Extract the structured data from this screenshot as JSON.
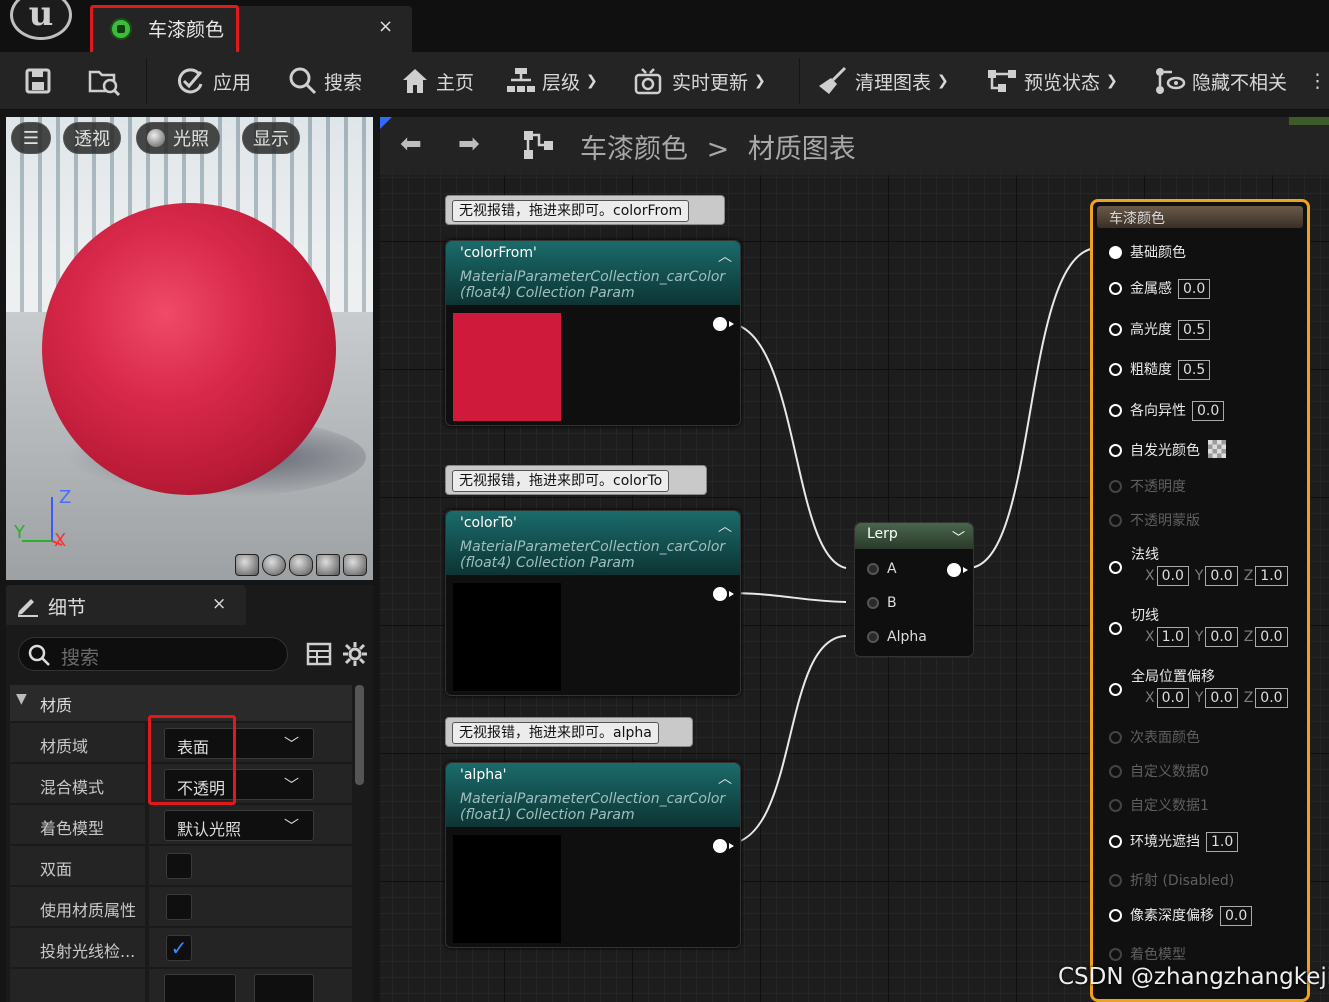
{
  "app": {
    "logo": "unreal-engine-logo"
  },
  "tab": {
    "title": "车漆颜色",
    "close": "×",
    "icon": "material-instance-icon"
  },
  "toolbar": {
    "save": "save-icon",
    "browse": "browse-icon",
    "apply": "应用",
    "search": "搜索",
    "home": "主页",
    "hierarchy": "层级",
    "live_update": "实时更新",
    "clean_graph": "清理图表",
    "preview_state": "预览状态",
    "hide_unrelated": "隐藏不相关",
    "more": "⋮"
  },
  "viewport": {
    "menu": "☰",
    "perspective": "透视",
    "lighting": "光照",
    "show": "显示",
    "axis_z": "Z",
    "axis_x": "X",
    "axis_y": "Y",
    "preview_color": "#cf1a3c"
  },
  "details": {
    "title": "细节",
    "close": "×",
    "search_placeholder": "搜索",
    "category": "材质",
    "rows": [
      {
        "label": "材质域",
        "value": "表面"
      },
      {
        "label": "混合模式",
        "value": "不透明"
      },
      {
        "label": "着色模型",
        "value": "默认光照"
      },
      {
        "label": "双面",
        "checked": false
      },
      {
        "label": "使用材质属性",
        "checked": false
      },
      {
        "label": "投射光线检...",
        "checked": true
      }
    ]
  },
  "graph": {
    "breadcrumb_asset": "车漆颜色",
    "breadcrumb_sep": ">",
    "breadcrumb_page": "材质图表",
    "comments": [
      "无视报错，拖进来即可。colorFrom",
      "无视报错，拖进来即可。colorTo",
      "无视报错，拖进来即可。alpha"
    ],
    "param_nodes": [
      {
        "name": "'colorFrom'",
        "sub1": "MaterialParameterCollection_carColor",
        "sub2": "(float4) Collection Param",
        "color": "#cf1a3c"
      },
      {
        "name": "'colorTo'",
        "sub1": "MaterialParameterCollection_carColor",
        "sub2": "(float4) Collection Param",
        "color": "#000000"
      },
      {
        "name": "'alpha'",
        "sub1": "MaterialParameterCollection_carColor",
        "sub2": "(float1) Collection Param",
        "color": "#000000"
      }
    ],
    "lerp": {
      "title": "Lerp",
      "a": "A",
      "b": "B",
      "alpha": "Alpha"
    },
    "result": {
      "title": "车漆颜色",
      "inputs": [
        {
          "label": "基础颜色"
        },
        {
          "label": "金属感",
          "value": "0.0"
        },
        {
          "label": "高光度",
          "value": "0.5"
        },
        {
          "label": "粗糙度",
          "value": "0.5"
        },
        {
          "label": "各向异性",
          "value": "0.0"
        },
        {
          "label": "自发光颜色"
        },
        {
          "label": "不透明度"
        },
        {
          "label": "不透明蒙版"
        },
        {
          "label": "法线",
          "x": "0.0",
          "y": "0.0",
          "z": "1.0"
        },
        {
          "label": "切线",
          "x": "1.0",
          "y": "0.0",
          "z": "0.0"
        },
        {
          "label": "全局位置偏移",
          "x": "0.0",
          "y": "0.0",
          "z": "0.0"
        },
        {
          "label": "次表面颜色"
        },
        {
          "label": "自定义数据0"
        },
        {
          "label": "自定义数据1"
        },
        {
          "label": "环境光遮挡",
          "value": "1.0"
        },
        {
          "label": "折射 (Disabled)"
        },
        {
          "label": "像素深度偏移",
          "value": "0.0"
        },
        {
          "label": "着色模型"
        }
      ]
    }
  },
  "watermark": "CSDN @zhangzhangkeji"
}
